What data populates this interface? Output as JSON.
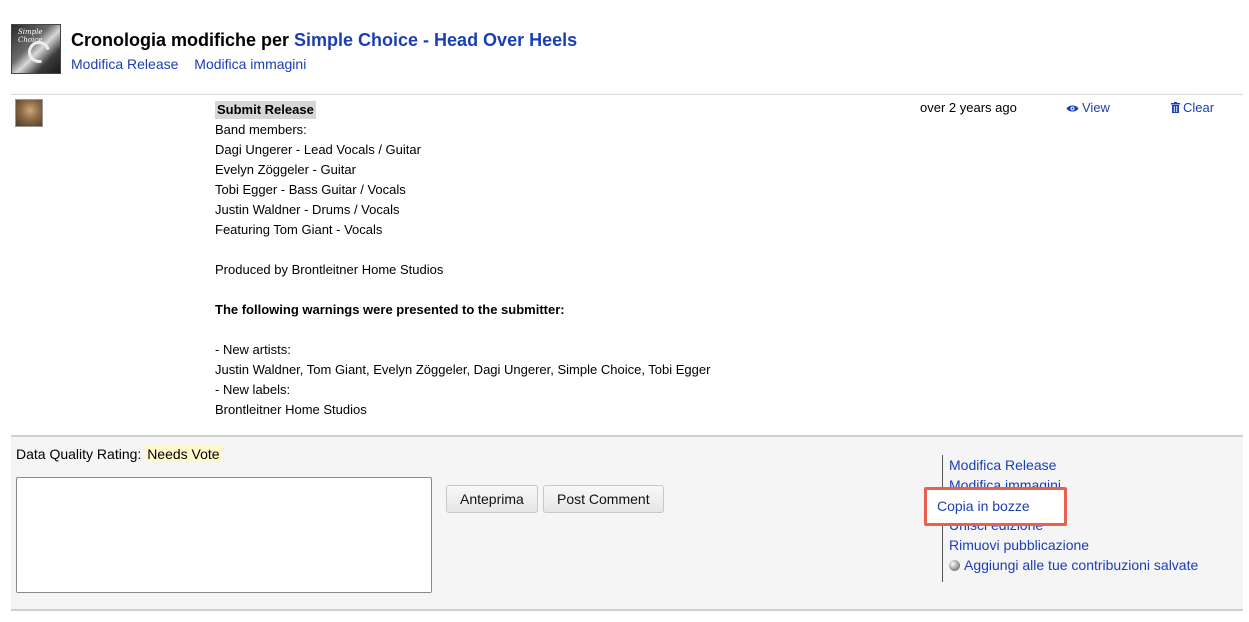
{
  "header": {
    "title_prefix": "Cronologia modifiche per ",
    "release_title": "Simple Choice - Head Over Heels",
    "links": [
      "Modifica Release",
      "Modifica immagini"
    ],
    "cover_text": "Simple Choice"
  },
  "history": {
    "action": "Submit Release",
    "lines": [
      "Band members:",
      "Dagi Ungerer - Lead Vocals / Guitar",
      "Evelyn Zöggeler - Guitar",
      "Tobi Egger - Bass Guitar / Vocals",
      "Justin Waldner - Drums / Vocals",
      "Featuring Tom Giant - Vocals"
    ],
    "produced": "Produced by Brontleitner Home Studios",
    "warnings_heading": "The following warnings were presented to the submitter:",
    "warnings": [
      "- New artists:",
      "Justin Waldner, Tom Giant, Evelyn Zöggeler, Dagi Ungerer, Simple Choice, Tobi Egger",
      "- New labels:",
      "Brontleitner Home Studios"
    ],
    "time": "over 2 years ago",
    "view_label": "View",
    "clear_label": "Clear"
  },
  "panel": {
    "dq_label": "Data Quality Rating:",
    "dq_value": "Needs Vote",
    "comment_value": "",
    "preview_button": "Anteprima",
    "post_button": "Post Comment",
    "side_links": [
      "Modifica Release",
      "Modifica immagini",
      "Copia in bozze",
      "Unisci edizione",
      "Rimuovi pubblicazione",
      "Aggiungi alle tue contribuzioni salvate"
    ]
  },
  "colors": {
    "link": "#1a3fb3",
    "highlight_border": "#e8604f",
    "needs_vote_bg": "#fff8c8"
  },
  "icons": {
    "view": "eye-icon",
    "clear": "trash-icon",
    "add_saved": "orb-icon"
  }
}
